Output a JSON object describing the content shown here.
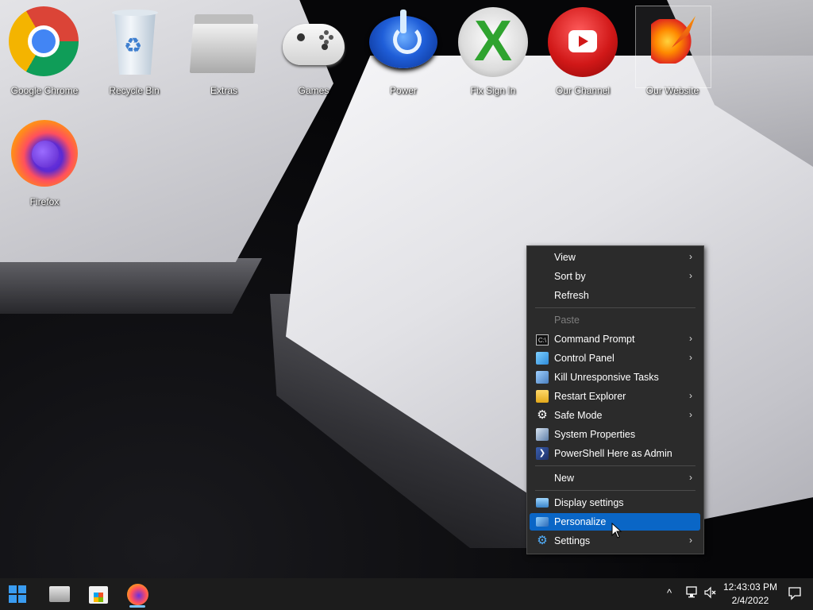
{
  "desktop": {
    "icons": [
      {
        "label": "Google Chrome",
        "icon": "chrome-icon"
      },
      {
        "label": "Recycle Bin",
        "icon": "recycle-bin-icon"
      },
      {
        "label": "Extras",
        "icon": "folder-icon"
      },
      {
        "label": "Games",
        "icon": "game-controller-icon"
      },
      {
        "label": "Power",
        "icon": "power-icon"
      },
      {
        "label": "Fix Sign In",
        "icon": "xbox-icon"
      },
      {
        "label": "Our Channel",
        "icon": "youtube-icon"
      },
      {
        "label": "Our Website",
        "icon": "phoenix-bird-icon"
      },
      {
        "label": "Firefox",
        "icon": "firefox-icon"
      }
    ]
  },
  "context_menu": {
    "items": [
      {
        "label": "View",
        "submenu": true
      },
      {
        "label": "Sort by",
        "submenu": true
      },
      {
        "label": "Refresh"
      },
      {
        "label": "Paste",
        "disabled": true
      },
      {
        "label": "Command Prompt",
        "submenu": true,
        "icon": "cmd-icon"
      },
      {
        "label": "Control Panel",
        "submenu": true,
        "icon": "control-panel-icon"
      },
      {
        "label": "Kill Unresponsive Tasks",
        "icon": "task-manager-icon"
      },
      {
        "label": "Restart Explorer",
        "submenu": true,
        "icon": "folder-icon"
      },
      {
        "label": "Safe Mode",
        "submenu": true,
        "icon": "gear-icon"
      },
      {
        "label": "System Properties",
        "icon": "system-properties-icon"
      },
      {
        "label": "PowerShell Here as Admin",
        "icon": "powershell-icon"
      },
      {
        "label": "New",
        "submenu": true
      },
      {
        "label": "Display settings",
        "icon": "display-icon"
      },
      {
        "label": "Personalize",
        "icon": "personalize-icon",
        "highlighted": true
      },
      {
        "label": "Settings",
        "submenu": true,
        "icon": "settings-gear-icon"
      }
    ],
    "submenu_glyph": "›",
    "cmd_glyph": "C:\\"
  },
  "taskbar": {
    "apps": [
      "start-icon",
      "file-explorer-icon",
      "microsoft-store-icon",
      "firefox-icon"
    ],
    "tray": {
      "chevron": "^",
      "time": "12:43:03 PM",
      "date": "2/4/2022"
    }
  },
  "colors": {
    "highlight": "#0a66c6",
    "menu_bg": "#2b2b2b",
    "taskbar_bg": "#1c1c1c",
    "start_blue": "#3a9cf0"
  }
}
